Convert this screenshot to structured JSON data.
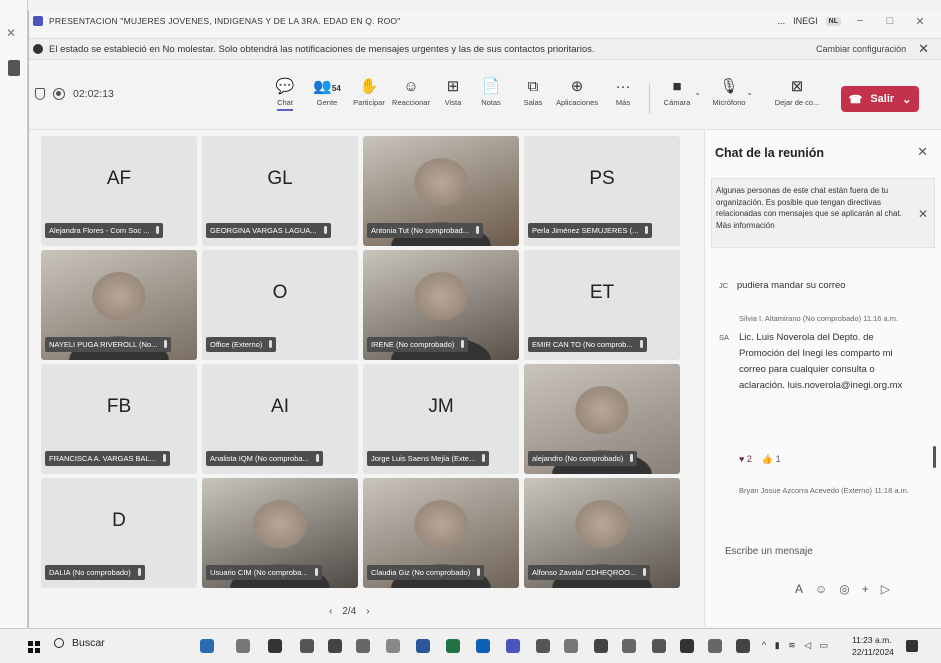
{
  "window": {
    "title": "PRESENTACION \"MUJERES JOVENES, INDIGENAS Y DE LA 3RA. EDAD EN Q. ROO\"",
    "more": "...",
    "org": "INEGI",
    "org_badge": "NL",
    "minimize": "−",
    "maximize": "□",
    "close": "✕"
  },
  "notification": {
    "text": "El estado se estableció en No molestar. Solo obtendrá las notificaciones de mensajes urgentes y las de sus contactos prioritarios.",
    "link": "Cambiar configuración",
    "close": "✕"
  },
  "toolbar": {
    "timer": "02:02:13",
    "people_count": "54",
    "items": [
      {
        "label": "Chat",
        "icon": "chat-icon",
        "glyph": "💬"
      },
      {
        "label": "Gente",
        "icon": "people-icon",
        "glyph": "👥"
      },
      {
        "label": "Participar",
        "icon": "raise-hand-icon",
        "glyph": "✋"
      },
      {
        "label": "Reaccionar",
        "icon": "react-icon",
        "glyph": "☺"
      },
      {
        "label": "Vista",
        "icon": "view-icon",
        "glyph": "⊞"
      },
      {
        "label": "Notas",
        "icon": "notes-icon",
        "glyph": "📄"
      },
      {
        "label": "Salas",
        "icon": "rooms-icon",
        "glyph": "⧉"
      },
      {
        "label": "Aplicaciones",
        "icon": "apps-icon",
        "glyph": "⊕"
      },
      {
        "label": "Más",
        "icon": "more-icon",
        "glyph": "···"
      },
      {
        "label": "Cámara",
        "icon": "camera-icon",
        "glyph": "■"
      },
      {
        "label": "Micrófono",
        "icon": "microphone-icon",
        "glyph": "🎙"
      },
      {
        "label": "Dejar de co...",
        "icon": "stop-share-icon",
        "glyph": "⊠"
      }
    ],
    "leave": "Salir"
  },
  "tiles": [
    {
      "initials": "AF",
      "name": "Alejandra Flores - Com Soc ...",
      "video": false
    },
    {
      "initials": "GL",
      "name": "GEORGINA VARGAS LAGUA...",
      "video": false
    },
    {
      "initials": "",
      "name": "Antonia Tut (No comprobad...",
      "video": true
    },
    {
      "initials": "PS",
      "name": "Perla Jiménez SEMUJERES (...",
      "video": false
    },
    {
      "initials": "",
      "name": "NAYELI PUGA RIVEROLL (No...",
      "video": true
    },
    {
      "initials": "O",
      "name": "Office (Externo)",
      "video": false
    },
    {
      "initials": "",
      "name": "IRENE (No comprobado)",
      "video": true
    },
    {
      "initials": "ET",
      "name": "EMIR CAN TO (No comprob...",
      "video": false
    },
    {
      "initials": "FB",
      "name": "FRANCISCA A. VARGAS BAL...",
      "video": false
    },
    {
      "initials": "AI",
      "name": "Analista IQM (No comproba...",
      "video": false
    },
    {
      "initials": "JM",
      "name": "Jorge Luis Saens Mejía (Exte...",
      "video": false
    },
    {
      "initials": "",
      "name": "alejandro (No comprobado)",
      "video": true
    },
    {
      "initials": "D",
      "name": "DALIA (No comprobado)",
      "video": false
    },
    {
      "initials": "",
      "name": "Usuario CIM (No comproba...",
      "video": true
    },
    {
      "initials": "",
      "name": "Claudia Giz (No comprobado)",
      "video": true
    },
    {
      "initials": "",
      "name": "Alfonso Zavala/ CDHEQROO...",
      "video": true
    }
  ],
  "pager": {
    "prev": "‹",
    "page": "2/4",
    "next": "›"
  },
  "chat": {
    "title": "Chat de la reunión",
    "close": "✕",
    "info": "Algunas personas de este chat están fuera de tu organización. Es posible que tengan directivas relacionadas con mensajes que se aplicarán al chat. Más información",
    "info_close": "✕",
    "msg1_tag": "JC",
    "msg1": "pudiera mandar su correo",
    "sender2": "Silvia I. Altamirano (No comprobado) 11:16 a.m.",
    "msg2_tag": "SA",
    "msg2": "Lic. Luis Noverola del Depto. de Promoción del Inegi les comparto mi correo para cualquier consulta o aclaración. luis.noverola@inegi.org.mx",
    "reaction_heart": "♥ 2",
    "reaction_like": "👍 1",
    "sender3": "Bryan Josue Azcorra Acevedo (Externo) 11:18 a.m.",
    "compose_placeholder": "Escribe un mensaje"
  },
  "taskbar": {
    "search": "Buscar",
    "time": "11:23 a.m.",
    "date": "22/11/2024"
  }
}
